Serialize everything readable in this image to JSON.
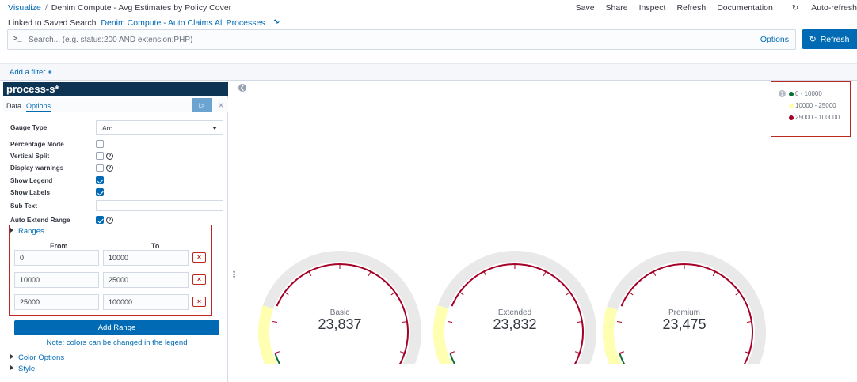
{
  "breadcrumb": {
    "root": "Visualize",
    "separator": "/",
    "current": "Denim Compute - Avg Estimates by Policy Cover"
  },
  "top_menu": [
    "Save",
    "Share",
    "Inspect",
    "Refresh",
    "Documentation",
    "Auto-refresh"
  ],
  "linked_search": {
    "label": "Linked to Saved Search",
    "name": "Denim Compute - Auto Claims All Processes"
  },
  "query": {
    "prompt": ">_",
    "placeholder": "Search... (e.g. status:200 AND extension:PHP)",
    "value": "",
    "options_label": "Options",
    "refresh_label": "Refresh"
  },
  "filter": {
    "add_label": "Add a filter"
  },
  "editor": {
    "index_pattern": "process-s*",
    "tabs": [
      "Data",
      "Options"
    ],
    "active_tab": "Options",
    "gauge_type": {
      "label": "Gauge Type",
      "value": "Arc"
    },
    "checkboxes": [
      {
        "label": "Percentage Mode",
        "checked": false,
        "help": false
      },
      {
        "label": "Vertical Split",
        "checked": false,
        "help": true
      },
      {
        "label": "Display warnings",
        "checked": false,
        "help": true
      },
      {
        "label": "Show Legend",
        "checked": true,
        "help": false
      },
      {
        "label": "Show Labels",
        "checked": true,
        "help": false
      }
    ],
    "sub_text": {
      "label": "Sub Text",
      "value": ""
    },
    "auto_extend": {
      "label": "Auto Extend Range",
      "checked": true
    },
    "ranges": {
      "label": "Ranges",
      "from_header": "From",
      "to_header": "To",
      "rows": [
        {
          "from": "0",
          "to": "10000"
        },
        {
          "from": "10000",
          "to": "25000"
        },
        {
          "from": "25000",
          "to": "100000"
        }
      ],
      "add_label": "Add Range",
      "note": "Note: colors can be changed in the legend"
    },
    "sections": [
      "Color Options",
      "Style"
    ]
  },
  "legend": {
    "items": [
      {
        "label": "0 - 10000",
        "color": "#0a6e2f"
      },
      {
        "label": "10000 - 25000",
        "color": "#ffffb2"
      },
      {
        "label": "25000 - 100000",
        "color": "#a50026"
      }
    ]
  },
  "gauges": [
    {
      "label": "Basic",
      "value": "23,837",
      "metric": 23837
    },
    {
      "label": "Extended",
      "value": "23,832",
      "metric": 23832
    },
    {
      "label": "Premium",
      "value": "23,475",
      "metric": 23475
    }
  ],
  "colors": {
    "accent": "#006bb4",
    "danger": "#bd271e",
    "header_dark": "#0e3453",
    "gauge_track": "#e9e9e9",
    "gauge_fill": "#ffffb2"
  }
}
